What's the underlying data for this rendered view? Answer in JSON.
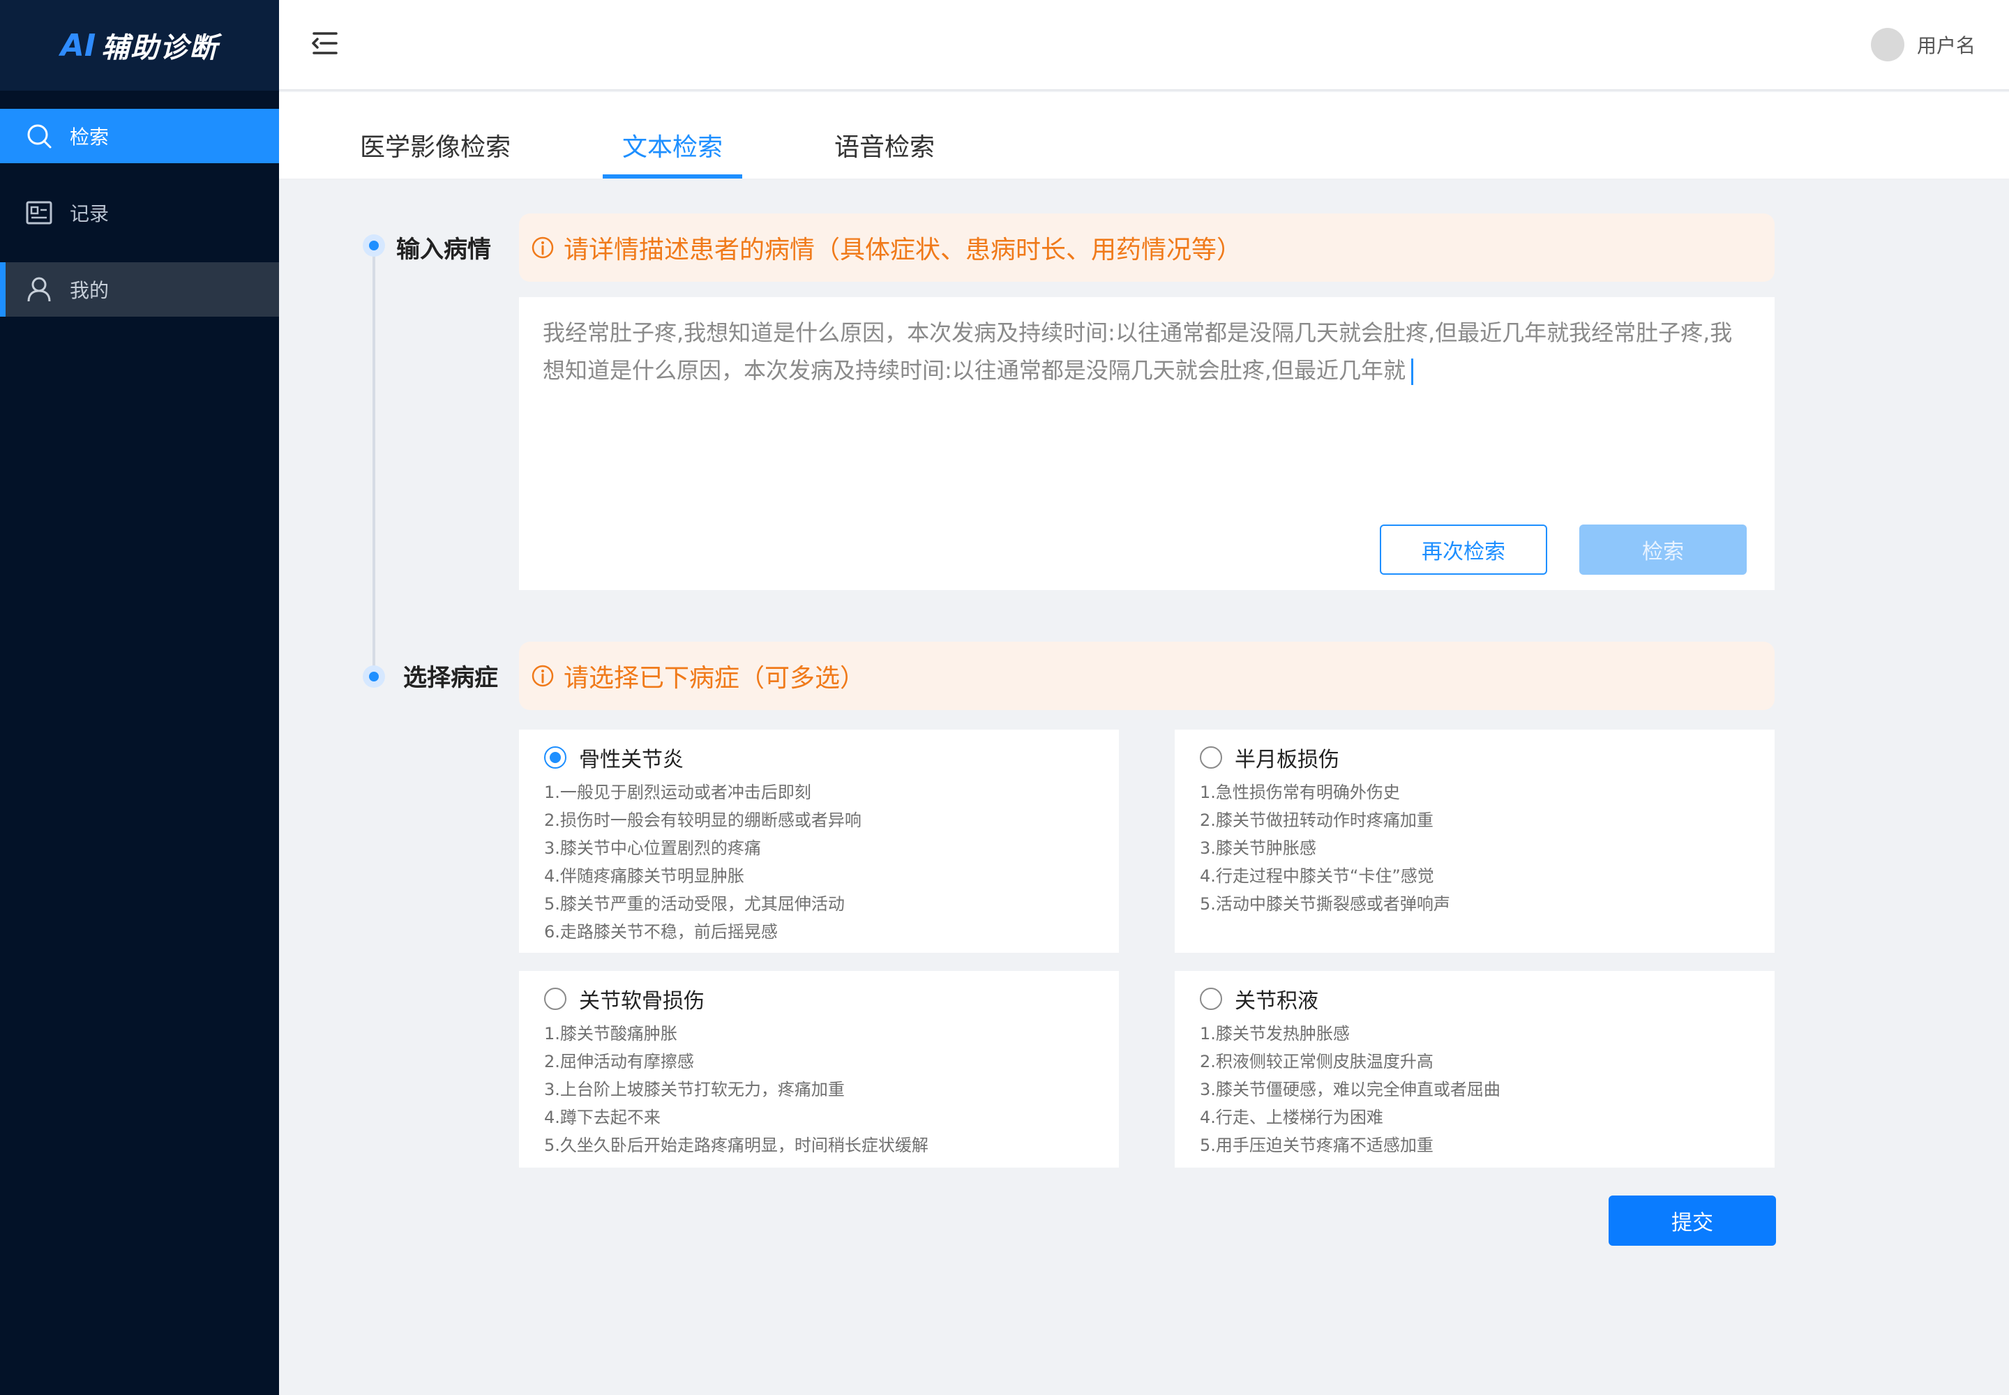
{
  "sidebar": {
    "logo_ai": "AI",
    "logo_text": "辅助诊断",
    "items": [
      {
        "label": "检索",
        "icon": "search-icon"
      },
      {
        "label": "记录",
        "icon": "record-icon"
      },
      {
        "label": "我的",
        "icon": "user-icon"
      }
    ]
  },
  "header": {
    "username": "用户名"
  },
  "tabs": [
    {
      "label": "医学影像检索"
    },
    {
      "label": "文本检索"
    },
    {
      "label": "语音检索"
    }
  ],
  "input_section": {
    "label": "输入病情",
    "notice": "请详情描述患者的病情（具体症状、患病时长、用药情况等）",
    "text_line1": "我经常肚子疼,我想知道是什么原因，本次发病及持续时间:以往通常都是没隔几天就会肚疼,但最近几年就我经常肚子疼,我",
    "text_line2": "想知道是什么原因，本次发病及持续时间:以往通常都是没隔几天就会肚疼,但最近几年就",
    "retry_button": "再次检索",
    "search_button": "检索"
  },
  "select_section": {
    "label": "选择病症",
    "notice": "请选择已下病症（可多选）",
    "cards": [
      {
        "title": "骨性关节炎",
        "checked": true,
        "lines": [
          "1.一般见于剧烈运动或者冲击后即刻",
          "2.损伤时一般会有较明显的绷断感或者异响",
          "3.膝关节中心位置剧烈的疼痛",
          "4.伴随疼痛膝关节明显肿胀",
          "5.膝关节严重的活动受限，尤其屈伸活动",
          "6.走路膝关节不稳，前后摇晃感"
        ]
      },
      {
        "title": "半月板损伤",
        "checked": false,
        "lines": [
          "1.急性损伤常有明确外伤史",
          "2.膝关节做扭转动作时疼痛加重",
          "3.膝关节肿胀感",
          "4.行走过程中膝关节“卡住”感觉",
          "5.活动中膝关节撕裂感或者弹响声"
        ]
      },
      {
        "title": "关节软骨损伤",
        "checked": false,
        "lines": [
          "1.膝关节酸痛肿胀",
          "2.屈伸活动有摩擦感",
          "3.上台阶上坡膝关节打软无力，疼痛加重",
          "4.蹲下去起不来",
          "5.久坐久卧后开始走路疼痛明显，时间稍长症状缓解"
        ]
      },
      {
        "title": "关节积液",
        "checked": false,
        "lines": [
          "1.膝关节发热肿胀感",
          "2.积液侧较正常侧皮肤温度升高",
          "3.膝关节僵硬感，难以完全伸直或者屈曲",
          "4.行走、上楼梯行为困难",
          "5.用手压迫关节疼痛不适感加重"
        ]
      }
    ],
    "submit_button": "提交"
  },
  "colors": {
    "primary": "#1e8fff",
    "sidebar_bg": "#031228",
    "notice_bg": "#fdf2ea",
    "notice_text": "#f07a1a"
  }
}
